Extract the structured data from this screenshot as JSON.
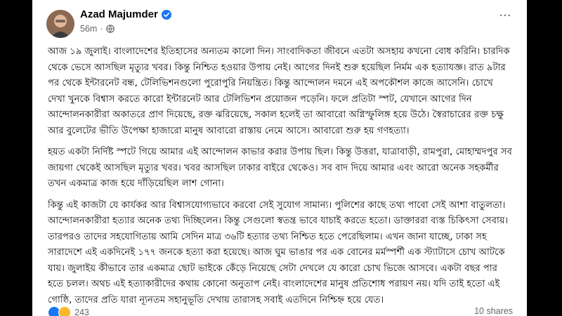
{
  "post": {
    "author": "Azad Majumder",
    "time": "56m",
    "separator": "·",
    "more_label": "···",
    "paragraphs": [
      "আজ ১৯ জুলাই। বাংলাদেশের ইতিহাসের অন্যতম কালো দিন। সাংবাদিকতা জীবনে এতটা অসহায় কখনো বোধ করিনি। চারদিক থেকে ভেসে আসছিল মৃত্যুর খবর। কিন্তু নিশ্চিত হওয়ার উপায় নেই। আগের দিনই শুরু হয়েছিল নির্মম এক হত্যাযজ্ঞ। রাত ৯টার পর থেকে ইন্টারনেট বন্ধ, টেলিভিশনগুলো পুরোপুরি নিয়ন্ত্রিত। কিন্তু আন্দোলন দমনে এই অপকৌশল কাজে আসেনি। চোখে দেখা খুনকে বিশ্বাস করতে কারো ইন্টারনেট আর টেলিভিশন প্রয়োজন পড়েনি। ফলে প্রতিটা স্পট, যেখানে আগের দিন আন্দোলনকারীরা অকাতরে প্রাণ দিয়েছে, রক্ত ঝরিয়েছে, সকাল হলেই তা আবারো অগ্নিস্ফুলিঙ্গ হয়ে উঠে। স্বৈরাচারের রক্ত চক্ষু আর বুলেটের ভীতি উপেক্ষা হাজারো মানুষ আবারো রাস্তায় নেমে আসে। আবারো শুরু হয় গণহত্যা।",
      "হয়ত একটা নির্দিষ্ট স্পটে গিয়ে আমার এই আন্দোলন কাভার করার উপায় ছিল। কিন্তু উত্তরা, যাত্রাবাড়ী, রামপুরা, মোহাম্মদপুর সব জায়গা থেকেই আসছিল মৃত্যুর খবর। খবর আসছিল ঢাকার বাইরে থেকেও। সব বাদ দিয়ে আমার এবং আরো অনেক সহকর্মীর তখন একমাত্র কাজ হয়ে দাঁড়িয়েছিল লাশ গোনা।",
      "কিন্তু এই কাজটা যে কার্যকর আর বিশ্বাসযোগ্যভাবে করবো সেই সুযোগ সামান্য। পুলিশের কাছে তথ্য পাবো সেই আশা বাতুলতা। আন্দোলনকারীরা হত্যার অনেক তথ্য দিচ্ছিলেন। কিন্তু সেগুলো স্বতন্ত্র ভাবে যাচাই করতে হতো। ডাক্তাররা ব্যস্ত চিকিৎসা সেবায়। তারপরও তাদের সহযোগিতায় আমি সেদিন মাত্র ৩৬টি হত্যার তথ্য নিশ্চিত হতে পেরেছিলাম। এখন জানা যাচ্ছে, ঢাকা সহ সারাদেশে এই একদিনেই ১৭৭ জনকে হত্যা করা হয়েছে। আজ ঘুম ভাঙার পর এক বোনের মর্মস্পর্শী এক স্ট্যাটাসে চোখ আটকে যায়। জুলাইয় কীভাবে তার একমাত্র ছোট ভাইকে কেঁড়ে নিয়েছে সেটা দেখলে যে কারো চোখ ভিজে আসবে। একটা বছর পার হতে চলল। অথচ এই হত্যাকারীদের কথায় কোনো অনুতাপ নেই। বাংলাদেশের মানুষ প্রতিশোধ পরায়ণ নয়। যদি তাই হতো এই গোষ্ঠি, তাদের প্রতি যারা ন্যূনতম সহানুভূতি দেখায় তারাসহ সবাই এতদিনে নিশ্চিহ্ন হয়ে যেত।"
    ],
    "reaction_count": "243",
    "shares": "10 shares"
  },
  "colors": {
    "background": "#000000",
    "card": "#ffffff",
    "text": "#050505",
    "muted": "#65676b",
    "verified": "#1877f2"
  },
  "icons": [
    "verified-badge-icon",
    "globe-icon",
    "more-options-icon",
    "like-reaction-icon",
    "care-reaction-icon"
  ]
}
